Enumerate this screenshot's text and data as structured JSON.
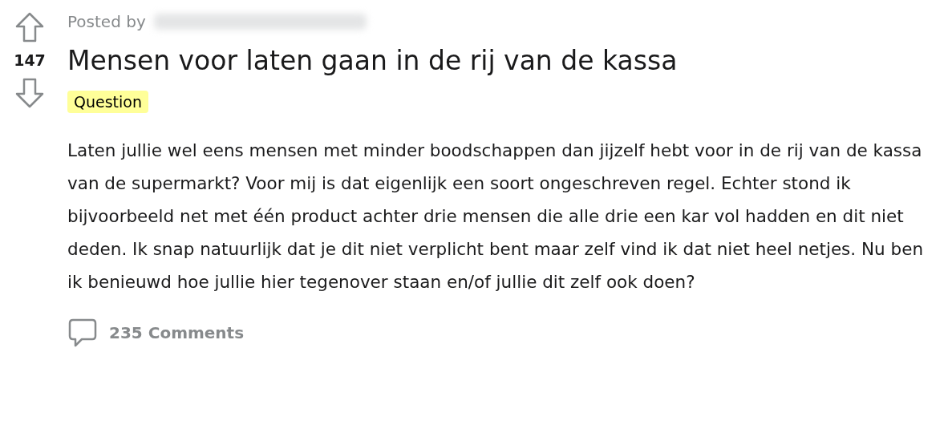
{
  "post": {
    "posted_by_label": "Posted by",
    "score": "147",
    "title": "Mensen voor laten gaan in de rij van de kassa",
    "flair": "Question",
    "body": "Laten jullie wel eens mensen met minder boodschappen dan jijzelf hebt voor in de rij van de kassa van de supermarkt? Voor mij is dat eigenlijk een soort ongeschreven regel. Echter stond ik bijvoorbeeld net met één product achter drie mensen die alle drie een kar vol hadden en dit niet deden. Ik snap natuurlijk dat je dit niet verplicht bent maar zelf vind ik dat niet heel netjes. Nu ben ik benieuwd hoe jullie hier tegenover staan en/of jullie dit zelf ook doen?",
    "comments": "235 Comments"
  }
}
